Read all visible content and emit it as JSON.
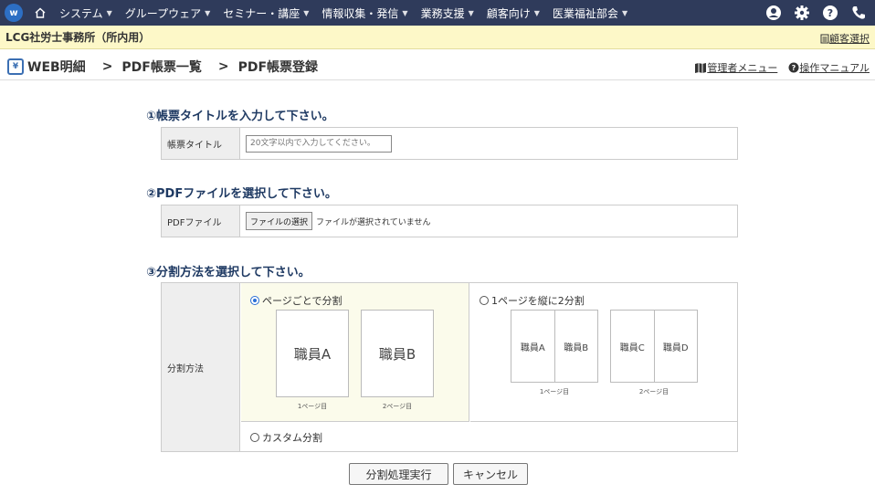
{
  "nav": {
    "logo": "w",
    "menu": [
      {
        "label": "システム"
      },
      {
        "label": "グループウェア"
      },
      {
        "label": "セミナー・講座"
      },
      {
        "label": "情報収集・発信"
      },
      {
        "label": "業務支援"
      },
      {
        "label": "顧客向け"
      },
      {
        "label": "医業福祉部会"
      }
    ],
    "right_icons": [
      "user-icon",
      "gear-icon",
      "help-icon",
      "phone-icon"
    ]
  },
  "office": {
    "name": "LCG社労士事務所（所内用）",
    "client_select_label": "顧客選択"
  },
  "breadcrumb": {
    "items": [
      "WEB明細",
      "PDF帳票一覧",
      "PDF帳票登録"
    ],
    "separator": ">",
    "admin_menu": "管理者メニュー",
    "manual": "操作マニュアル"
  },
  "form": {
    "step1_title": "①帳票タイトルを入力して下さい。",
    "title_label": "帳票タイトル",
    "title_placeholder": "20文字以内で入力してください。",
    "title_value": "",
    "step2_title": "②PDFファイルを選択して下さい。",
    "file_label": "PDFファイル",
    "file_button": "ファイルの選択",
    "file_status": "ファイルが選択されていません",
    "step3_title": "③分割方法を選択して下さい。",
    "split_label": "分割方法",
    "options": {
      "per_page": {
        "label": "ページごとで分割",
        "selected": true,
        "pages": [
          {
            "name": "職員A",
            "caption": "1ページ目"
          },
          {
            "name": "職員B",
            "caption": "2ページ目"
          }
        ]
      },
      "vertical_half": {
        "label": "1ページを縦に2分割",
        "selected": false,
        "pages": [
          {
            "left": "職員A",
            "right": "職員B",
            "caption": "1ページ目"
          },
          {
            "left": "職員C",
            "right": "職員D",
            "caption": "2ページ目"
          }
        ]
      },
      "custom": {
        "label": "カスタム分割",
        "selected": false
      }
    },
    "submit_label": "分割処理実行",
    "cancel_label": "キャンセル"
  },
  "colors": {
    "nav_bg": "#2f3b5b",
    "office_bar_bg": "#fdf8c8",
    "section_title": "#1f3a63",
    "selected_option_bg": "#fbfbeb"
  }
}
